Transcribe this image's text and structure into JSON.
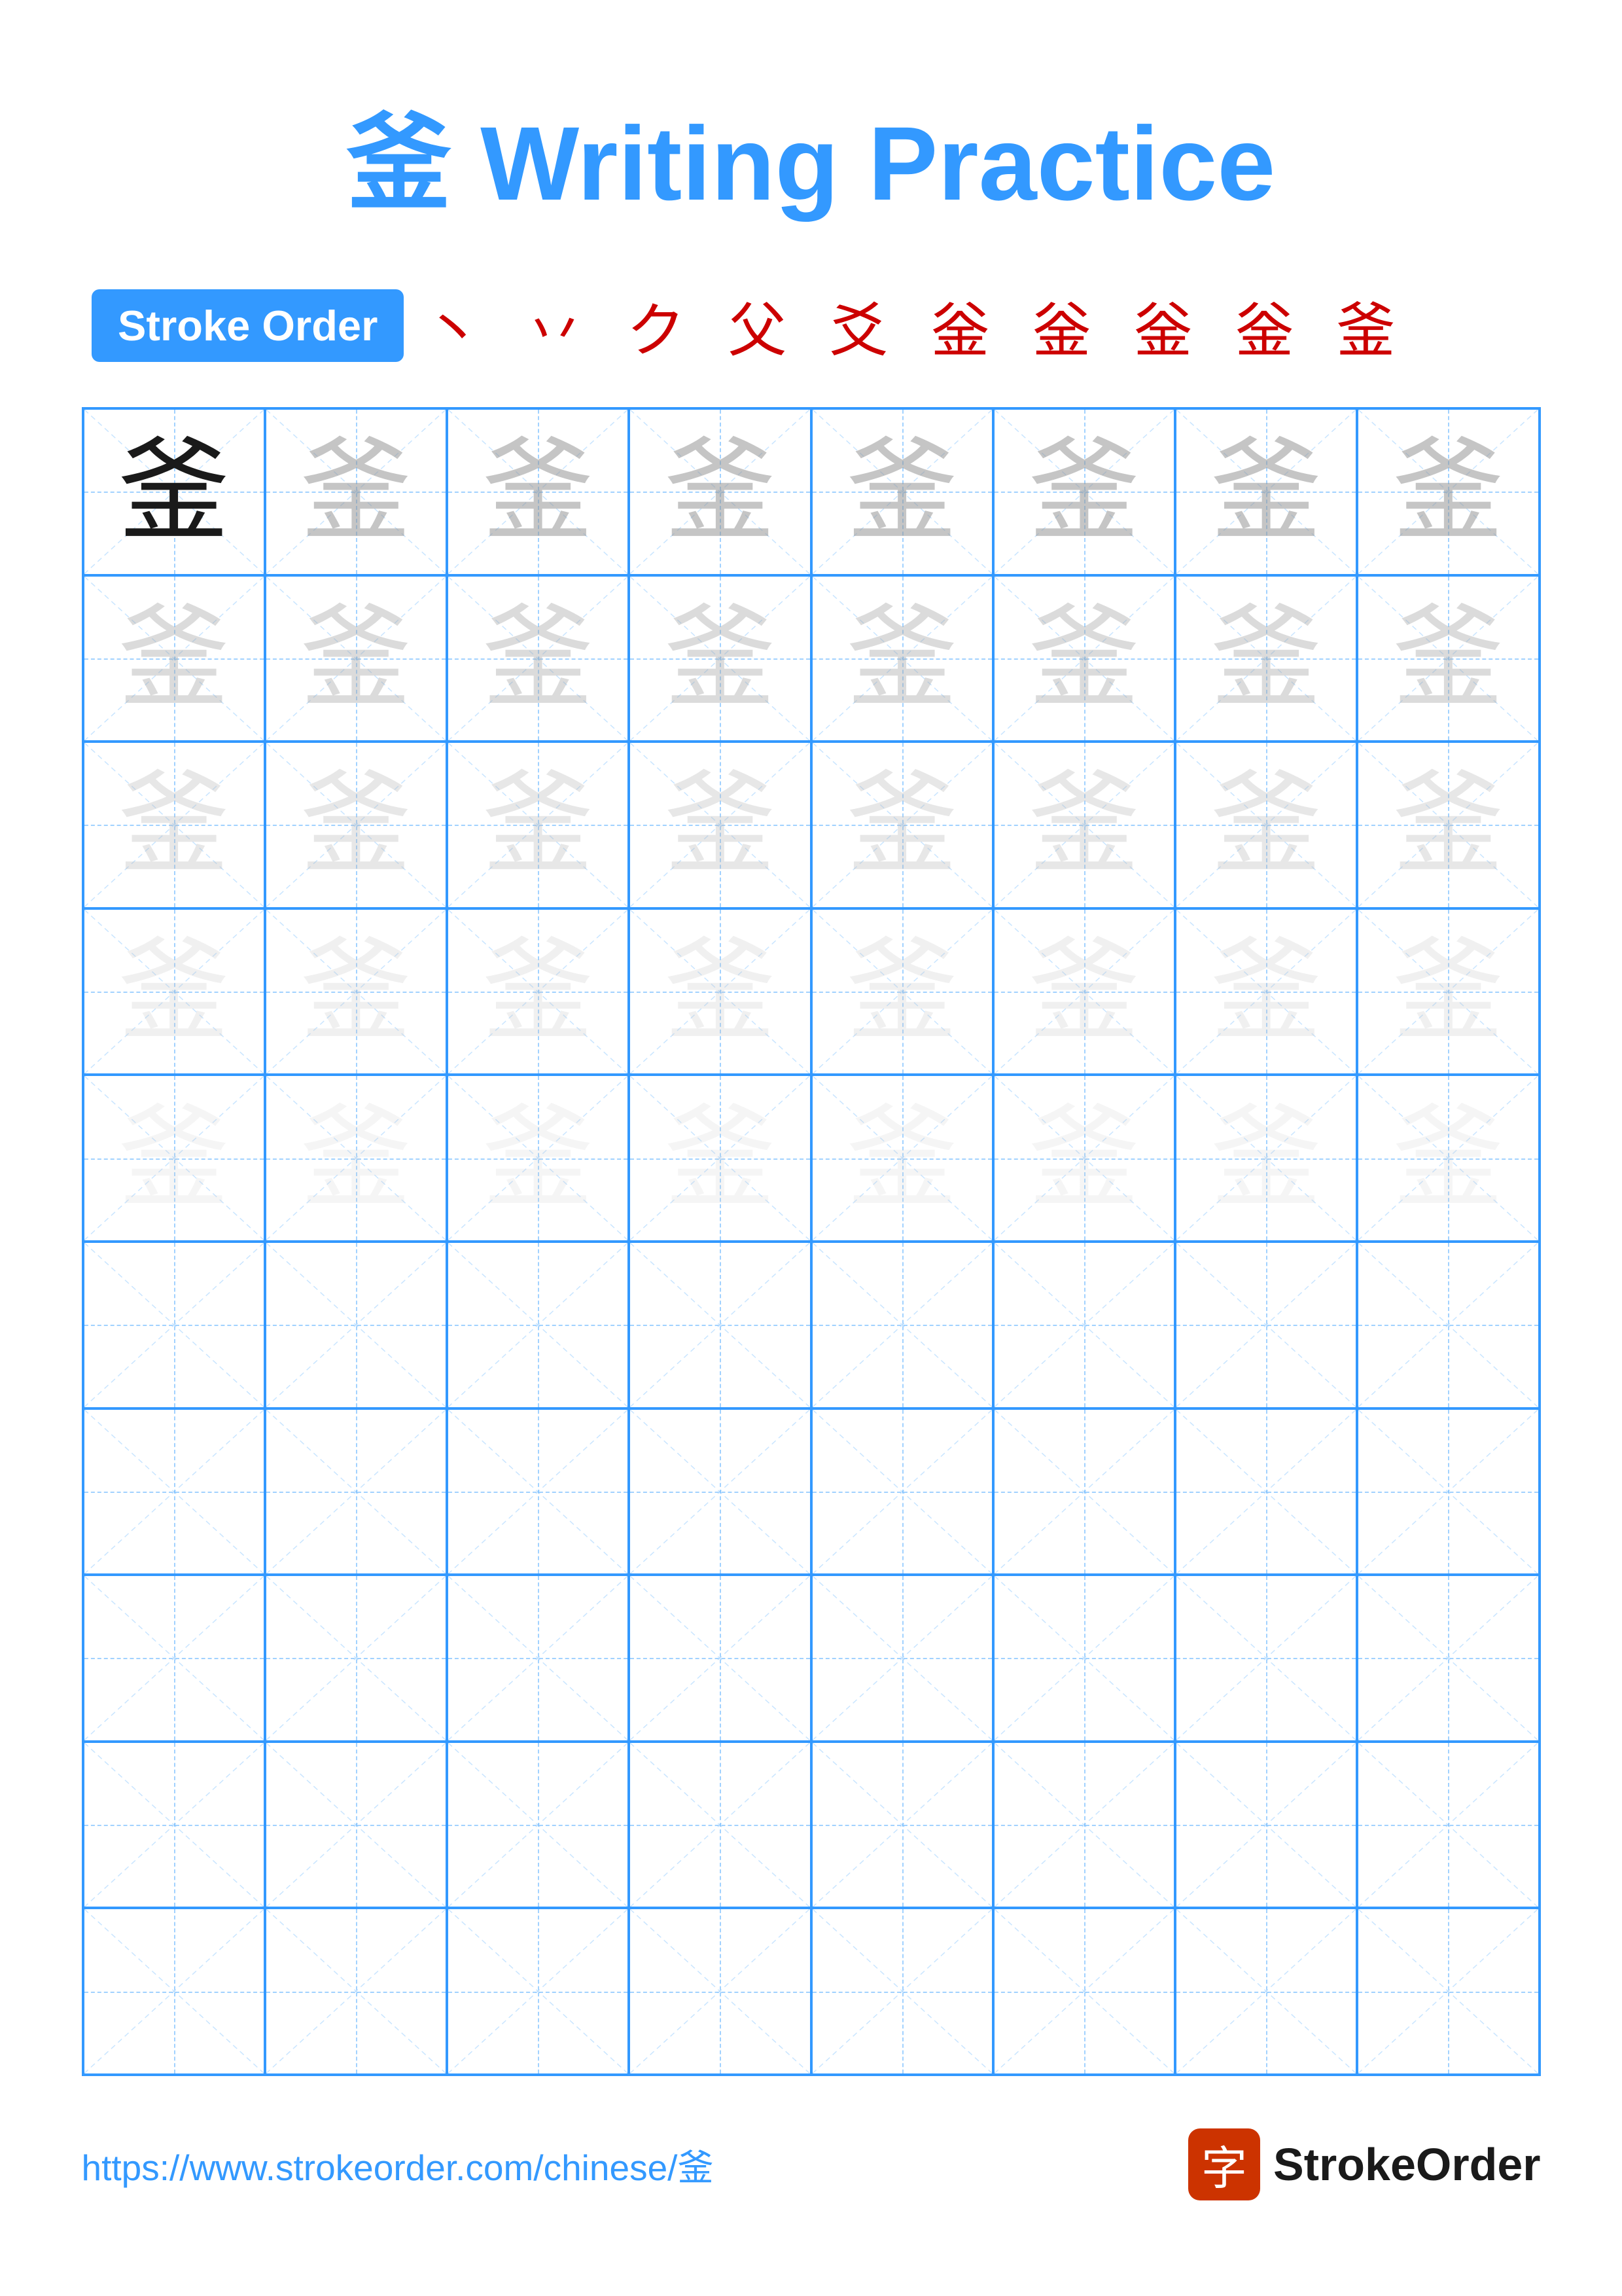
{
  "title": "釜 Writing Practice",
  "stroke_order": {
    "badge": "Stroke Order",
    "chars": "丶 丷 ク 父 爻 釡 釡 釡 釡 釜"
  },
  "character": "釜",
  "grid": {
    "rows": 10,
    "cols": 8,
    "filled_rows": 5,
    "empty_rows": 5
  },
  "footer": {
    "url": "https://www.strokeorder.com/chinese/釜",
    "brand": "StrokeOrder",
    "logo_char": "字"
  }
}
